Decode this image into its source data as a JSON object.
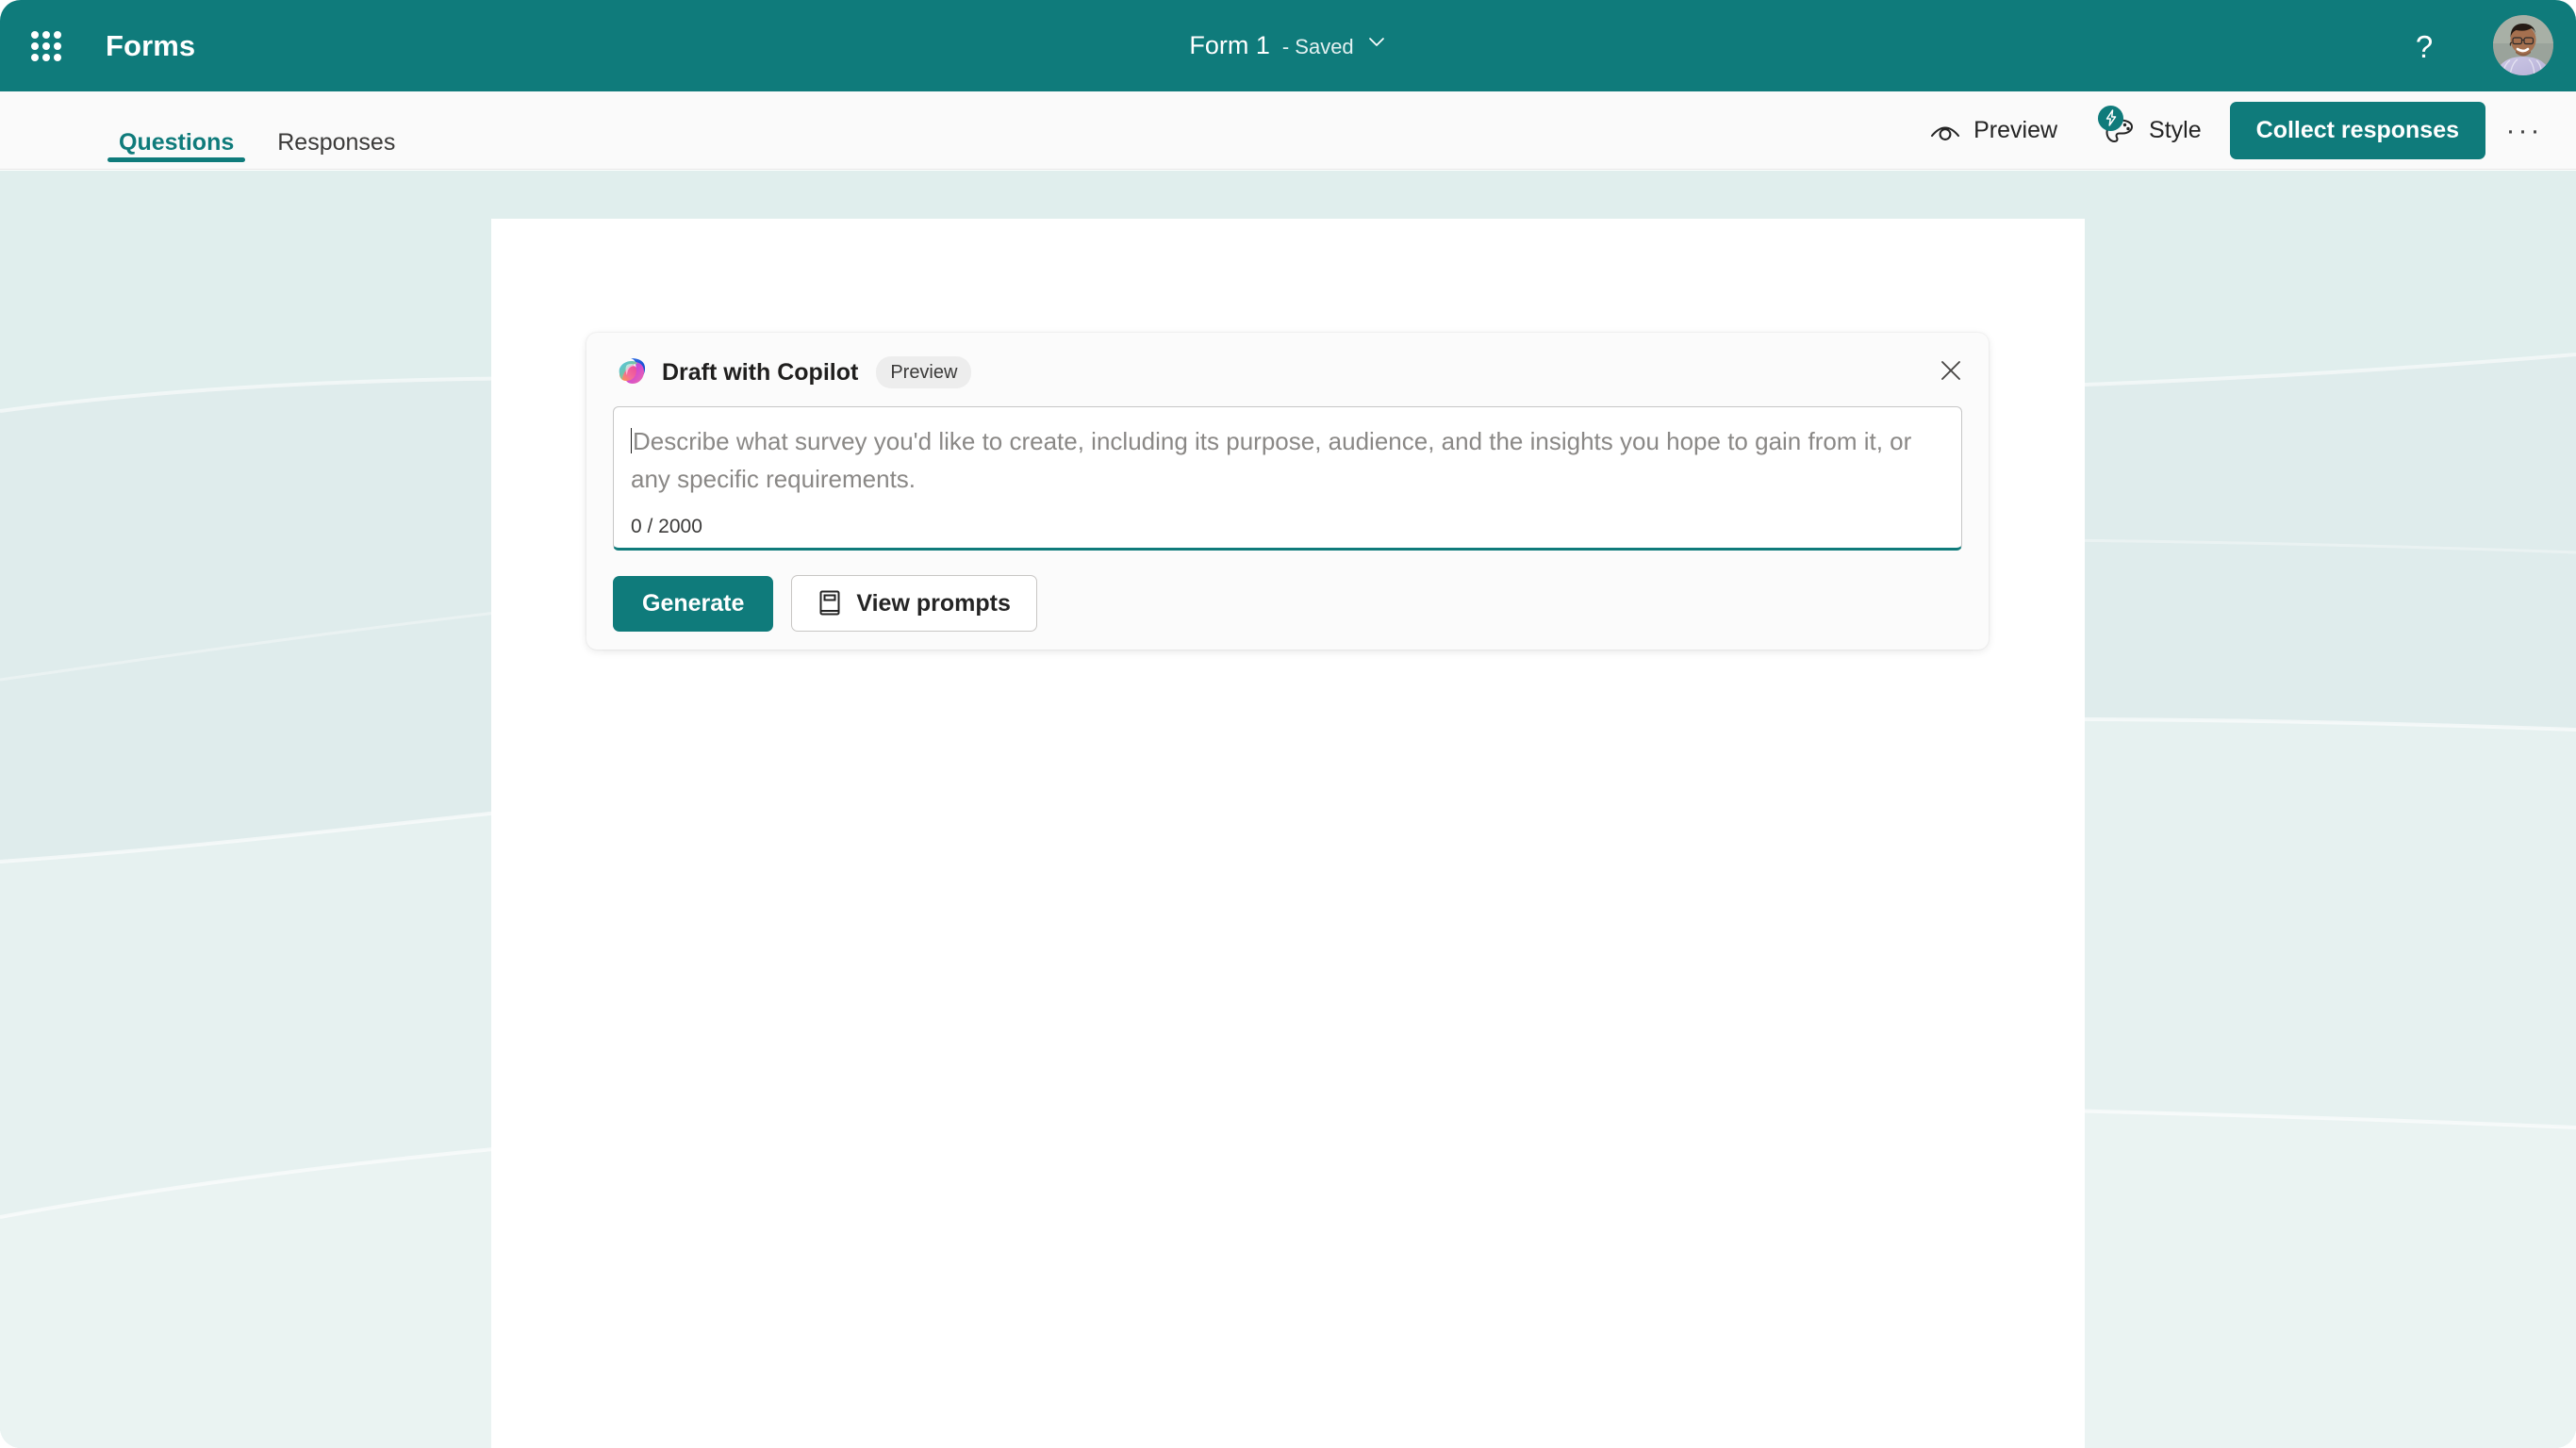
{
  "app": {
    "name": "Forms",
    "waffle_icon": "app-launcher-grid-icon",
    "brand_color": "#0f7b7b"
  },
  "header": {
    "doc_title": "Form 1",
    "doc_status": "- Saved",
    "chevron_icon": "chevron-down-icon",
    "help_label": "?",
    "help_icon": "question-mark-icon",
    "avatar_icon": "user-avatar"
  },
  "command_bar": {
    "tabs": [
      {
        "label": "Questions",
        "active": true
      },
      {
        "label": "Responses",
        "active": false
      }
    ],
    "preview": {
      "label": "Preview",
      "icon": "eye-icon"
    },
    "style": {
      "label": "Style",
      "icon": "palette-icon",
      "badge_icon": "lightning-bolt-icon"
    },
    "collect_responses_label": "Collect responses",
    "more_label": "···",
    "more_icon": "ellipsis-icon"
  },
  "copilot": {
    "logo_icon": "copilot-logo-icon",
    "title": "Draft with Copilot",
    "badge": "Preview",
    "close_icon": "close-icon",
    "input": {
      "value": "",
      "placeholder": "Describe what survey you'd like to create, including its purpose, audience, and the insights you hope to gain from it, or any specific requirements.",
      "counter": "0 / 2000",
      "max_length": 2000
    },
    "generate_label": "Generate",
    "view_prompts_label": "View prompts",
    "view_prompts_icon": "book-icon"
  },
  "colors": {
    "accent": "#0f7b7b",
    "header_bg": "#0f7b7b",
    "canvas_bg": "#dfecec",
    "sheet_bg": "#ffffff",
    "card_bg": "#fbfbfb"
  }
}
